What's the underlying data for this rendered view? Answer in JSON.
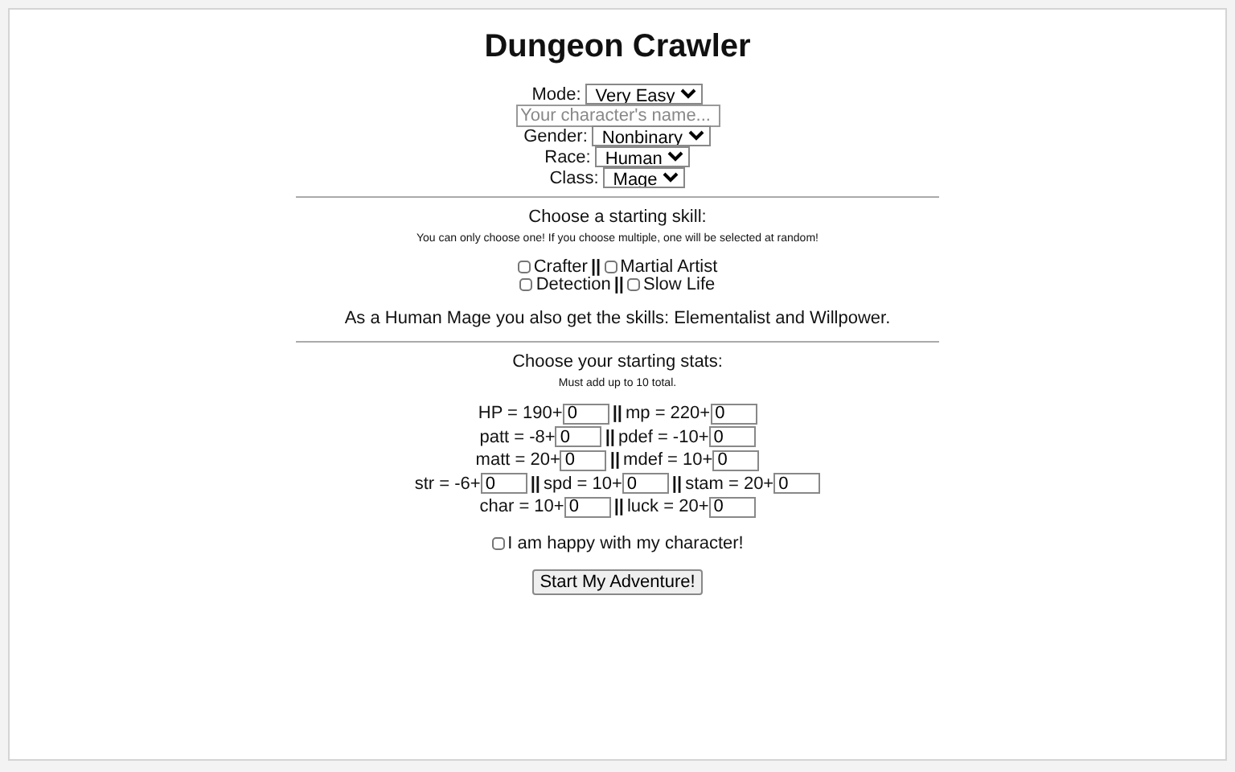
{
  "title": "Dungeon Crawler",
  "form_fields": [
    {
      "kind": "select",
      "label": "Mode:",
      "value": "Very Easy"
    },
    {
      "kind": "text",
      "placeholder": "Your character's name..."
    },
    {
      "kind": "select",
      "label": "Gender:",
      "value": "Nonbinary"
    },
    {
      "kind": "select",
      "label": "Race:",
      "value": "Human"
    },
    {
      "kind": "select",
      "label": "Class:",
      "value": "Mage"
    }
  ],
  "skills": {
    "heading": "Choose a starting skill:",
    "note": "You can only choose one! If you choose multiple, one will be selected at random!",
    "separator": "||",
    "rows": [
      [
        {
          "label": "Crafter",
          "checked": false
        },
        {
          "label": "Martial Artist",
          "checked": false
        }
      ],
      [
        {
          "label": "Detection",
          "checked": false
        },
        {
          "label": "Slow Life",
          "checked": false
        }
      ]
    ],
    "bonus": "As a Human Mage you also get the skills: Elementalist and Willpower."
  },
  "stats": {
    "heading": "Choose your starting stats:",
    "note": "Must add up to 10 total.",
    "separator": "||",
    "rows": [
      [
        {
          "label": "HP = 190+",
          "value": "0"
        },
        {
          "label": "mp = 220+",
          "value": "0"
        }
      ],
      [
        {
          "label": "patt = -8+",
          "value": "0"
        },
        {
          "label": "pdef = -10+",
          "value": "0"
        }
      ],
      [
        {
          "label": "matt = 20+",
          "value": "0"
        },
        {
          "label": "mdef = 10+",
          "value": "0"
        }
      ],
      [
        {
          "label": "str = -6+",
          "value": "0"
        },
        {
          "label": "spd = 10+",
          "value": "0"
        },
        {
          "label": "stam = 20+",
          "value": "0"
        }
      ],
      [
        {
          "label": "char = 10+",
          "value": "0"
        },
        {
          "label": "luck = 20+",
          "value": "0"
        }
      ]
    ]
  },
  "confirm": {
    "label": "I am happy with my character!",
    "checked": false
  },
  "start_button": "Start My Adventure!"
}
